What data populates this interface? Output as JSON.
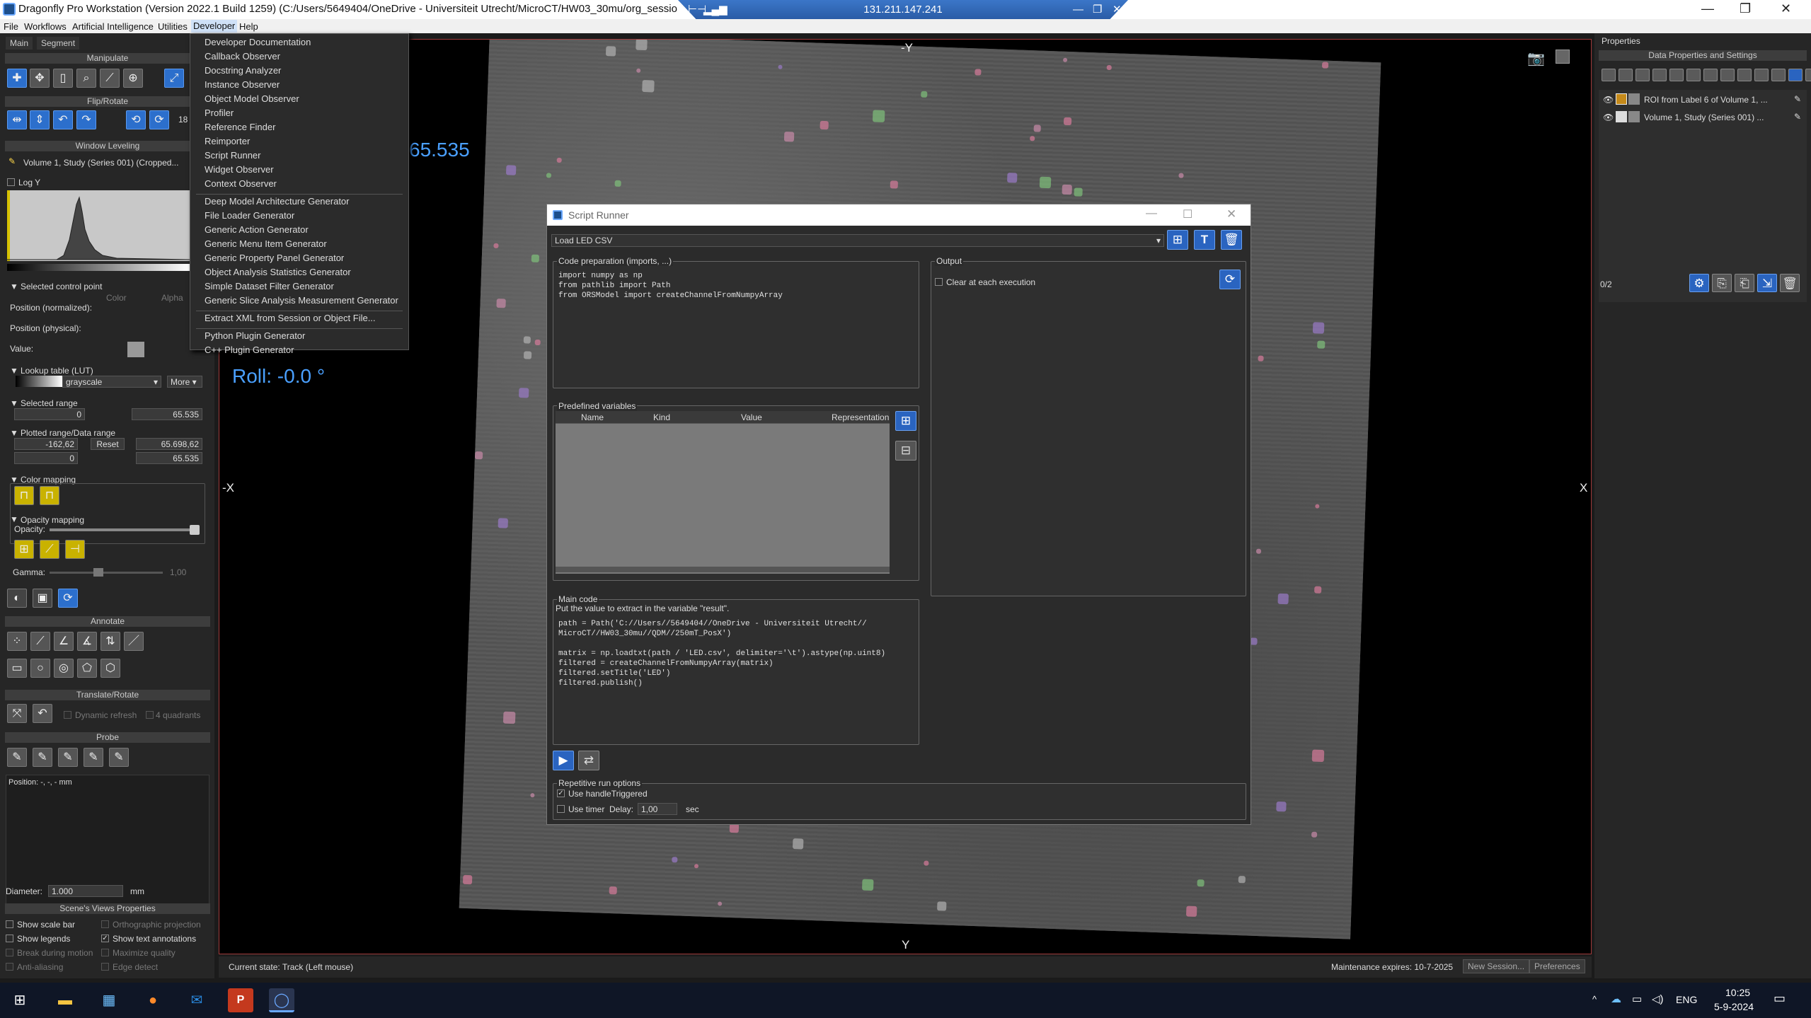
{
  "window": {
    "title": "Dragonfly Pro Workstation (Version 2022.1 Build 1259) (C:/Users/5649404/OneDrive - Universiteit Utrecht/MicroCT/HW03_30mu/org_sessio",
    "remote_host": "131.211.147.241"
  },
  "menubar": [
    "File",
    "Workflows",
    "Artificial Intelligence",
    "Utilities",
    "Developer",
    "Help"
  ],
  "developer_menu": {
    "group1": [
      "Developer Documentation",
      "Callback Observer",
      "Docstring Analyzer",
      "Instance Observer",
      "Object Model Observer",
      "Profiler",
      "Reference Finder",
      "Reimporter",
      "Script Runner",
      "Widget Observer",
      "Context Observer"
    ],
    "group2": [
      "Deep Model Architecture Generator",
      "File Loader Generator",
      "Generic Action Generator",
      "Generic Menu Item Generator",
      "Generic Property Panel Generator",
      "Object Analysis Statistics Generator",
      "Simple Dataset Filter Generator",
      "Generic Slice Analysis Measurement Generator"
    ],
    "group3": [
      "Extract XML from Session or Object File..."
    ],
    "group4": [
      "Python Plugin Generator",
      "C++ Plugin Generator"
    ]
  },
  "left": {
    "tabs": [
      "Main",
      "Segment"
    ],
    "sections": {
      "manipulate": "Manipulate",
      "flip_rotate": "Flip/Rotate",
      "window_leveling": "Window Leveling",
      "annotate": "Annotate",
      "translate_rotate": "Translate/Rotate",
      "probe": "Probe",
      "scene_views": "Scene's Views Properties"
    },
    "flip_value": "18",
    "dataset": "Volume 1, Study  (Series 001) (Cropped...",
    "log_y": "Log Y",
    "control_point": {
      "title": "Selected control point",
      "color": "Color",
      "alpha": "Alpha",
      "pos_norm": "Position (normalized):",
      "pos_phys": "Position (physical):",
      "value": "Value:"
    },
    "lut": {
      "title": "Lookup table (LUT)",
      "value": "grayscale",
      "more": "More"
    },
    "selected_range": {
      "title": "Selected range",
      "min": "0",
      "max": "65.535"
    },
    "plotted_range": {
      "title": "Plotted range/Data range",
      "min": "-162,62",
      "reset": "Reset",
      "max": "65.698,62",
      "dmin": "0",
      "dmax": "65.535"
    },
    "color_mapping": "Color mapping",
    "opacity_mapping": "Opacity mapping",
    "opacity_label": "Opacity:",
    "gamma_label": "Gamma:",
    "gamma_value": "1,00",
    "dynamic_refresh": "Dynamic refresh",
    "four_quadrants": "4 quadrants",
    "probe_position": "Position: -, -, - mm",
    "diameter_label": "Diameter:",
    "diameter_value": "1.000",
    "diameter_unit": "mm",
    "checks": {
      "scale_bar": "Show scale bar",
      "ortho": "Orthographic projection",
      "legends": "Show legends",
      "text_ann": "Show text annotations",
      "break_motion": "Break during motion",
      "maximize": "Maximize quality",
      "antialias": "Anti-aliasing",
      "edge": "Edge detect"
    }
  },
  "viewport": {
    "label_top": "-Y",
    "label_bottom": "Y",
    "label_left": "-X",
    "label_right": "X",
    "wl_value": "65.535",
    "roll": "Roll: -0.0 °"
  },
  "script_runner": {
    "title": "Script Runner",
    "script_select": "Load LED CSV",
    "code_prep": {
      "title": "Code preparation (imports, ...)",
      "code": "import numpy as np\nfrom pathlib import Path\nfrom ORSModel import createChannelFromNumpyArray"
    },
    "output": {
      "title": "Output",
      "clear": "Clear at each execution"
    },
    "predefined": {
      "title": "Predefined variables",
      "columns": [
        "Name",
        "Kind",
        "Value",
        "Representation"
      ]
    },
    "main_code": {
      "title": "Main code",
      "hint": "Put the value to extract in the variable \"result\".",
      "code": "path = Path('C://Users//5649404//OneDrive - Universiteit Utrecht//\nMicroCT//HW03_30mu//QDM//250mT_PosX')\n\nmatrix = np.loadtxt(path / 'LED.csv', delimiter='\\t').astype(np.uint8)\nfiltered = createChannelFromNumpyArray(matrix)\nfiltered.setTitle('LED')\nfiltered.publish()"
    },
    "repetitive": {
      "title": "Repetitive run options",
      "handle": "Use handleTriggered",
      "timer": "Use timer",
      "delay_label": "Delay:",
      "delay_value": "1,00",
      "unit": "sec"
    }
  },
  "right": {
    "header": "Properties",
    "subheader": "Data Properties and Settings",
    "items": [
      "ROI from Label 6 of Volume 1, ...",
      "Volume 1, Study  (Series 001) ..."
    ],
    "count": "0/2"
  },
  "status": {
    "state": "Current state: Track (Left mouse)",
    "maintenance": "Maintenance expires: 10-7-2025",
    "new_session": "New Session...",
    "preferences": "Preferences"
  },
  "taskbar": {
    "lang": "ENG",
    "time": "10:25",
    "date": "5-9-2024"
  },
  "colors": {
    "accent": "#2a64c0",
    "bg": "#262626",
    "roll_text": "#4aa0ff"
  }
}
